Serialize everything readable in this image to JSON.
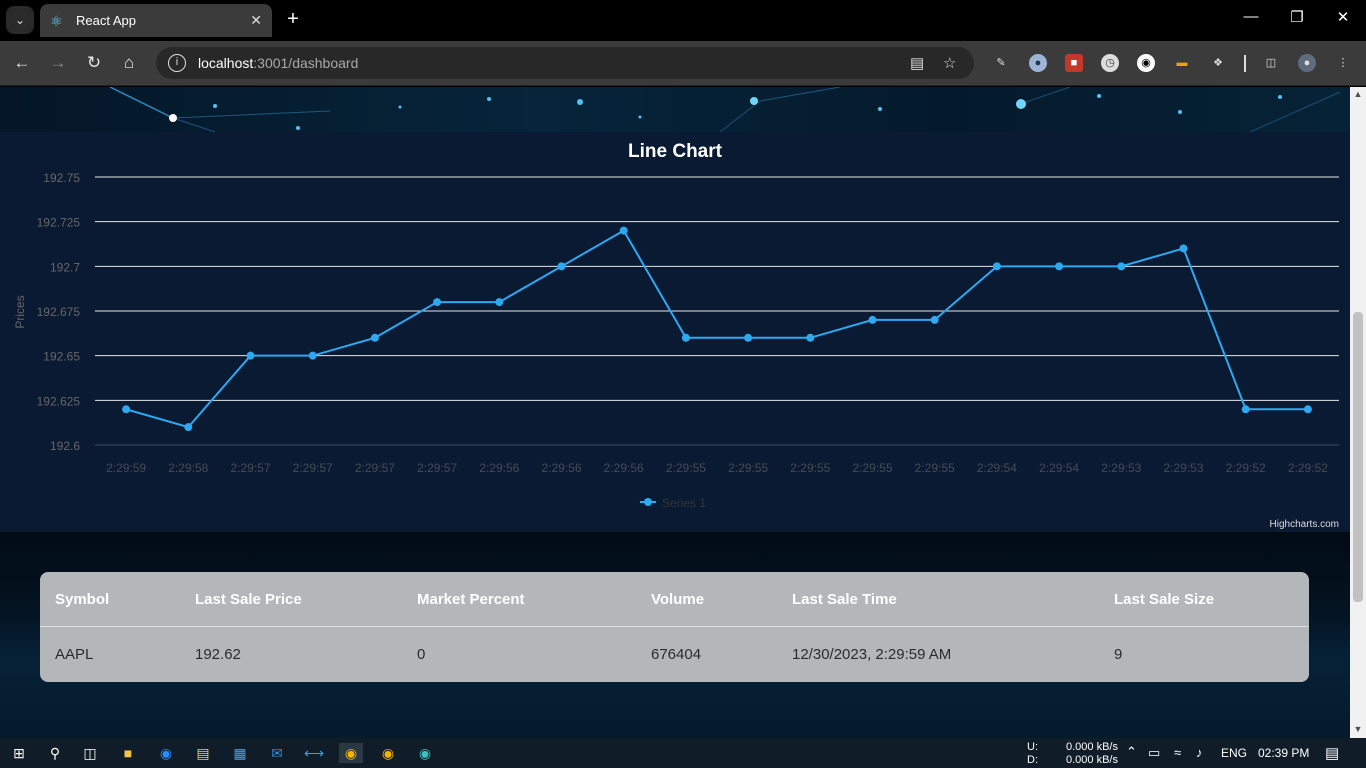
{
  "browser": {
    "tab_title": "React App",
    "url_host": "localhost",
    "url_rest": ":3001/dashboard"
  },
  "chart_data": {
    "type": "line",
    "title": "Line Chart",
    "ylabel": "Prices",
    "xlabel": "",
    "ylim": [
      192.6,
      192.75
    ],
    "yticks": [
      "192.6",
      "192.625",
      "192.65",
      "192.675",
      "192.7",
      "192.725",
      "192.75"
    ],
    "categories": [
      "2:29:59",
      "2:29:58",
      "2:29:57",
      "2:29:57",
      "2:29:57",
      "2:29:57",
      "2:29:56",
      "2:29:56",
      "2:29:56",
      "2:29:55",
      "2:29:55",
      "2:29:55",
      "2:29:55",
      "2:29:55",
      "2:29:54",
      "2:29:54",
      "2:29:53",
      "2:29:53",
      "2:29:52",
      "2:29:52"
    ],
    "series": [
      {
        "name": "Series 1",
        "color": "#2ca9f1",
        "values": [
          192.62,
          192.61,
          192.65,
          192.65,
          192.66,
          192.68,
          192.68,
          192.7,
          192.72,
          192.66,
          192.66,
          192.66,
          192.67,
          192.67,
          192.7,
          192.7,
          192.7,
          192.71,
          192.62,
          192.62
        ]
      }
    ],
    "grid": true,
    "legend": "bottom-center",
    "credits": "Highcharts.com"
  },
  "table": {
    "headers": [
      "Symbol",
      "Last Sale Price",
      "Market Percent",
      "Volume",
      "Last Sale Time",
      "Last Sale Size"
    ],
    "row": [
      "AAPL",
      "192.62",
      "0",
      "676404",
      "12/30/2023, 2:29:59 AM",
      "9"
    ]
  },
  "taskbar": {
    "net_up_label": "U:",
    "net_down_label": "D:",
    "net_up": "0.000 kB/s",
    "net_down": "0.000 kB/s",
    "language": "ENG",
    "time": "02:39 PM"
  }
}
